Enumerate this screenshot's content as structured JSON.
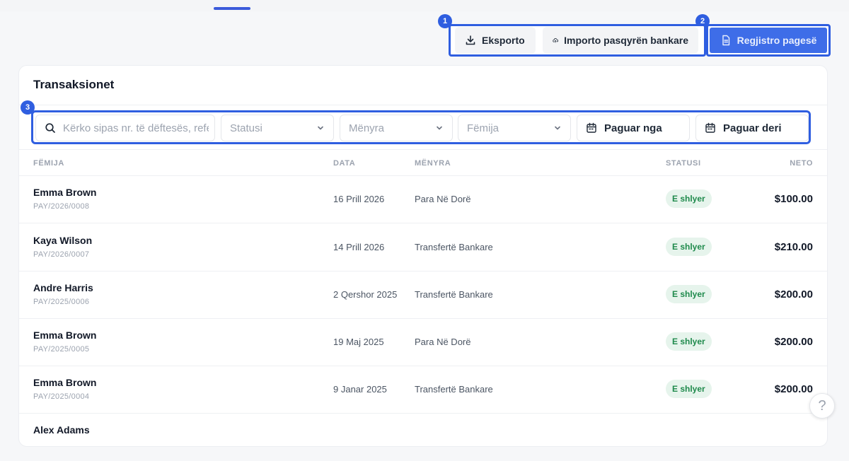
{
  "toolbar": {
    "export_label": "Eksporto",
    "import_label": "Importo pasqyrën bankare",
    "register_label": "Regjistro pagesë",
    "badges": [
      "1",
      "2",
      "3"
    ]
  },
  "card": {
    "title": "Transaksionet",
    "filters": {
      "search_placeholder": "Kërko sipas nr. të dëftesës, referencës…",
      "status_placeholder": "Statusi",
      "method_placeholder": "Mënyra",
      "child_placeholder": "Fëmija",
      "paid_from_label": "Paguar nga",
      "paid_to_label": "Paguar deri"
    },
    "columns": {
      "child": "FËMIJA",
      "date": "DATA",
      "method": "MËNYRA",
      "status": "STATUSI",
      "net": "NETO"
    },
    "rows": [
      {
        "name": "Emma Brown",
        "ref": "PAY/2026/0008",
        "date": "16 Prill 2026",
        "method": "Para Në Dorë",
        "status": "E shlyer",
        "net": "$100.00"
      },
      {
        "name": "Kaya Wilson",
        "ref": "PAY/2026/0007",
        "date": "14 Prill 2026",
        "method": "Transfertë Bankare",
        "status": "E shlyer",
        "net": "$210.00"
      },
      {
        "name": "Andre Harris",
        "ref": "PAY/2025/0006",
        "date": "2 Qershor 2025",
        "method": "Transfertë Bankare",
        "status": "E shlyer",
        "net": "$200.00"
      },
      {
        "name": "Emma Brown",
        "ref": "PAY/2025/0005",
        "date": "19 Maj 2025",
        "method": "Para Në Dorë",
        "status": "E shlyer",
        "net": "$200.00"
      },
      {
        "name": "Emma Brown",
        "ref": "PAY/2025/0004",
        "date": "9 Janar 2025",
        "method": "Transfertë Bankare",
        "status": "E shlyer",
        "net": "$200.00"
      },
      {
        "name": "Alex Adams",
        "ref": "",
        "date": "",
        "method": "",
        "status": "",
        "net": ""
      }
    ]
  },
  "help": {
    "label": "?"
  },
  "colors": {
    "accent": "#2f5ee0",
    "primary_button": "#3e6de8",
    "status_bg": "#e6f4ec",
    "status_text": "#1f8a4c"
  },
  "icons": [
    "download-icon",
    "cloud-upload-icon",
    "document-icon",
    "search-icon",
    "chevron-down-icon",
    "calendar-icon",
    "help-icon"
  ]
}
